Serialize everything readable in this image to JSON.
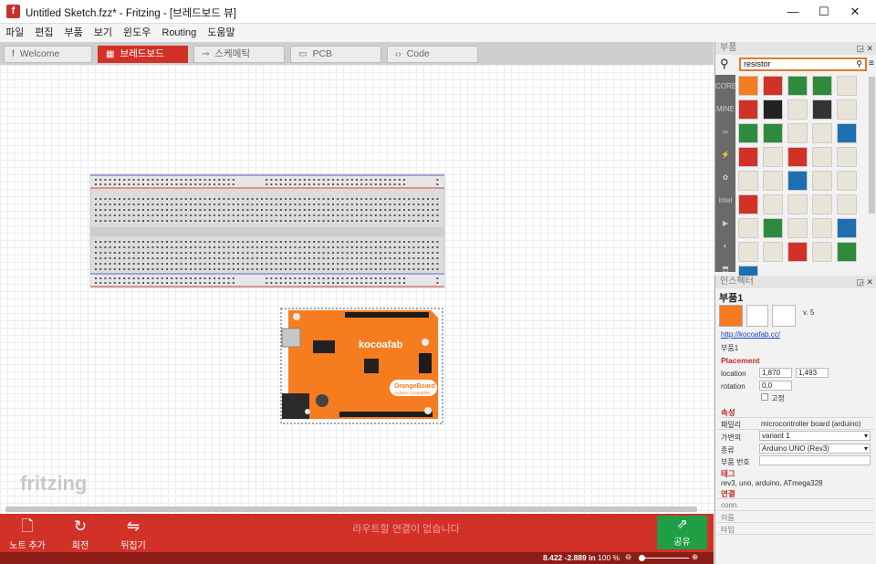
{
  "window": {
    "title": "Untitled Sketch.fzz* - Fritzing - [브레드보드 뷰]",
    "app_icon": "f",
    "minimize": "—",
    "maximize": "☐",
    "close": "✕"
  },
  "menu": [
    "파일",
    "편집",
    "부품",
    "보기",
    "윈도우",
    "Routing",
    "도움말"
  ],
  "tabs": [
    {
      "label": "Welcome",
      "icon": "f"
    },
    {
      "label": "브레드보드",
      "icon": "▦"
    },
    {
      "label": "스케메틱",
      "icon": "⊸"
    },
    {
      "label": "PCB",
      "icon": "▭"
    },
    {
      "label": "Code",
      "icon": "‹›"
    }
  ],
  "canvas": {
    "watermark": "fritzing",
    "board_brand": "kocoafab",
    "board_name": "OrangeBoard",
    "board_sub": "Arduino Compatible"
  },
  "bottom": {
    "add_note": "노트 추가",
    "rotate": "회전",
    "flip": "뒤집기",
    "routing_status": "라우트할 연결이 없습니다",
    "share": "공유"
  },
  "status": {
    "coords": "8.422 -2.889 in",
    "zoom": "100 %"
  },
  "parts": {
    "title": "부품",
    "search_value": "resistor",
    "bins": [
      "CORE",
      "MINE",
      "∞",
      "⚡",
      "✿",
      "intel",
      "▶",
      "◐",
      "⬒"
    ]
  },
  "inspector": {
    "title": "인스펙터",
    "part_name": "부품1",
    "version": "v. 5",
    "link": "http://kocoafab.cc/",
    "part_label": "부품1",
    "placement": {
      "heading": "Placement",
      "location_label": "location",
      "x": "1,870",
      "y": "1,493",
      "rotation_label": "rotation",
      "rotation": "0,0",
      "locked": "고정"
    },
    "properties": {
      "heading": "속성",
      "family_label": "패밀리",
      "family": "microcontroller board (arduino)",
      "variant_label": "가변의",
      "variant": "variant 1",
      "type_label": "종류",
      "type": "Arduino UNO (Rev3)",
      "part_number_label": "부품 번호",
      "part_number": ""
    },
    "tags": {
      "heading": "태그",
      "value": "rev3, uno, arduino, ATmega328"
    },
    "connections": {
      "heading": "연결",
      "conn": "conn.",
      "name": "이름",
      "type": "타입"
    }
  },
  "colors": {
    "accent": "#d23128",
    "share": "#1f9e45",
    "arduino": "#f57c1f"
  }
}
